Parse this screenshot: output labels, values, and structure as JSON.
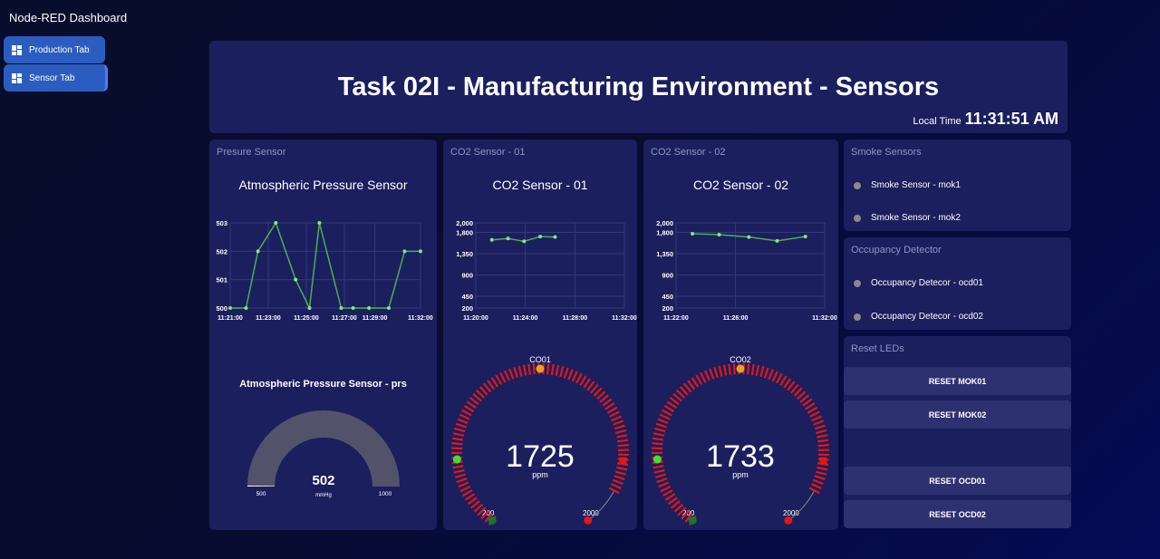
{
  "app": {
    "title": "Node-RED Dashboard"
  },
  "nav": [
    {
      "label": "Production Tab",
      "icon": "dashboard-icon"
    },
    {
      "label": "Sensor Tab",
      "icon": "dashboard-icon"
    }
  ],
  "header": {
    "title": "Task 02I - Manufacturing Environment - Sensors",
    "time_label": "Local Time",
    "time": "11:31:51 AM"
  },
  "pressure": {
    "group_title": "Presure Sensor",
    "chart_title": "Atmospheric Pressure Sensor",
    "gauge_title": "Atmospheric Pressure Sensor - prs",
    "gauge_value": "502",
    "gauge_unit": "mmHg",
    "gauge_min": "500",
    "gauge_max": "1000",
    "gauge_fraction": 0.004
  },
  "co2_1": {
    "group_title": "CO2 Sensor - 01",
    "chart_title": "CO2 Sensor - 01",
    "gauge_title": "CO01",
    "gauge_value": "1725",
    "gauge_unit": "ppm",
    "gauge_min": "200",
    "gauge_max": "2000"
  },
  "co2_2": {
    "group_title": "CO2 Sensor - 02",
    "chart_title": "CO2 Sensor - 02",
    "gauge_title": "CO02",
    "gauge_value": "1733",
    "gauge_unit": "ppm",
    "gauge_min": "200",
    "gauge_max": "2000"
  },
  "smoke": {
    "group_title": "Smoke Sensors",
    "items": [
      "Smoke Sensor - mok1",
      "Smoke Sensor - mok2"
    ]
  },
  "occupancy": {
    "group_title": "Occupancy Detector",
    "items": [
      "Occupancy Detecor - ocd01",
      "Occupancy Detecor - ocd02"
    ]
  },
  "reset": {
    "group_title": "Reset LEDs",
    "buttons": [
      "RESET MOK01",
      "RESET MOK02",
      "RESET OCD01",
      "RESET OCD02"
    ]
  },
  "colors": {
    "line": "#4caf50",
    "gauge_red": "#e01818",
    "gauge_orange": "#f0a020",
    "gauge_green": "#44dd33",
    "led_off": "#8a8a8a"
  },
  "chart_data": [
    {
      "type": "line",
      "title": "Atmospheric Pressure Sensor",
      "x_ticks": [
        "11:21:00",
        "11:23:00",
        "11:25:00",
        "11:27:00",
        "11:29:00",
        "11:32:00"
      ],
      "y_ticks": [
        "500",
        "501",
        "502",
        "503"
      ],
      "ylim": [
        500,
        503
      ],
      "x_minutes": [
        11.2,
        11.6,
        11.9,
        12.35,
        12.85,
        13.2,
        13.45,
        14.0,
        14.3,
        14.7,
        15.2,
        15.6,
        16.0
      ],
      "values": [
        500,
        500,
        502,
        503,
        501,
        500,
        503,
        500,
        500,
        500,
        500,
        502,
        502
      ]
    },
    {
      "type": "line",
      "title": "CO2 Sensor - 01",
      "x_ticks": [
        "11:20:00",
        "11:24:00",
        "11:28:00",
        "11:32:00"
      ],
      "y_ticks": [
        "200",
        "450",
        "900",
        "1,350",
        "1,800",
        "2,000"
      ],
      "ylim": [
        200,
        2000
      ],
      "x_minutes": [
        21.3,
        22.6,
        23.9,
        25.2,
        26.4
      ],
      "values": [
        1640,
        1670,
        1610,
        1710,
        1700
      ]
    },
    {
      "type": "line",
      "title": "CO2 Sensor - 02",
      "x_ticks": [
        "11:22:00",
        "11:26:00",
        "11:32:00"
      ],
      "y_ticks": [
        "200",
        "450",
        "900",
        "1,350",
        "1,800",
        "2,000"
      ],
      "ylim": [
        200,
        2000
      ],
      "x_minutes": [
        23.1,
        24.9,
        26.9,
        28.8,
        30.7
      ],
      "values": [
        1770,
        1750,
        1700,
        1620,
        1710
      ]
    }
  ]
}
